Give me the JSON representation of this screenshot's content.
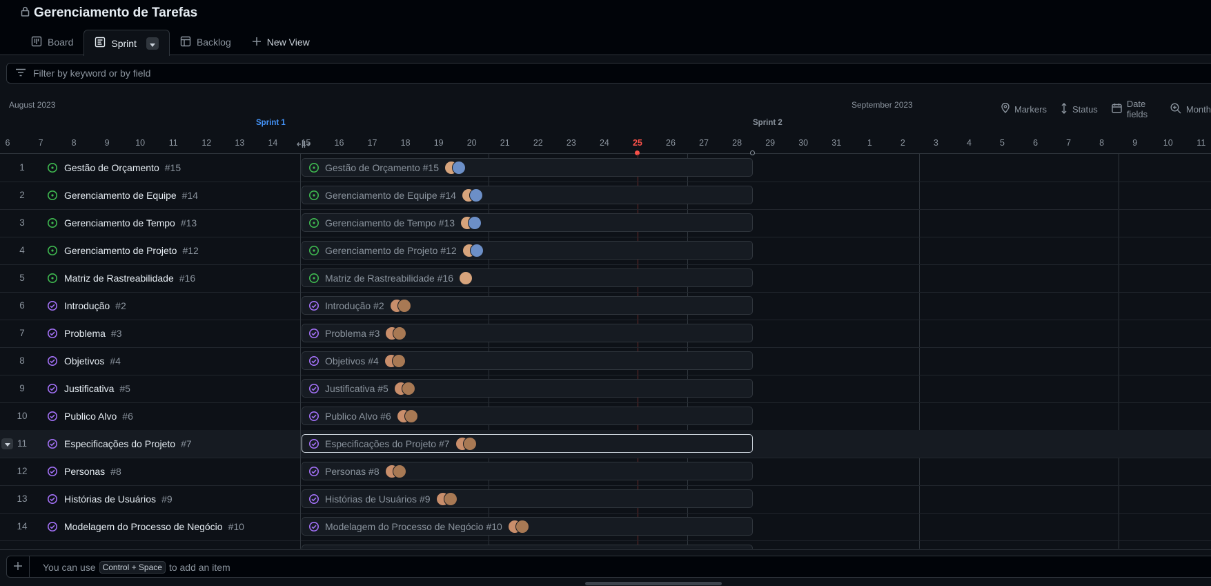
{
  "header": {
    "title": "Gerenciamento de Tarefas",
    "tabs": [
      {
        "label": "Board",
        "icon": "board-icon"
      },
      {
        "label": "Sprint",
        "icon": "roadmap-icon",
        "active": true
      },
      {
        "label": "Backlog",
        "icon": "table-icon"
      },
      {
        "label": "New View",
        "icon": "plus-icon"
      }
    ]
  },
  "filter": {
    "placeholder": "Filter by keyword or by field"
  },
  "timeline": {
    "months": [
      "August 2023",
      "September 2023"
    ],
    "sprints": [
      {
        "label": "Sprint 1",
        "color": "#4493f8"
      },
      {
        "label": "Sprint 2",
        "color": "#8b949e"
      }
    ],
    "days": [
      "6",
      "7",
      "8",
      "9",
      "10",
      "11",
      "12",
      "13",
      "14",
      "15",
      "16",
      "17",
      "18",
      "19",
      "20",
      "21",
      "22",
      "23",
      "24",
      "25",
      "26",
      "27",
      "28",
      "29",
      "30",
      "31",
      "1",
      "2",
      "3",
      "4",
      "5",
      "6",
      "7",
      "8",
      "9",
      "10",
      "11"
    ],
    "today": "25"
  },
  "toolbar": {
    "markers": "Markers",
    "status": "Status",
    "date_fields": "Date fields",
    "zoom": "Month"
  },
  "colors": {
    "in_progress": "#3fb950",
    "done": "#a371f7",
    "today": "#f85149",
    "sprint_active": "#4493f8"
  },
  "rows": [
    {
      "n": "1",
      "title": "Gestão de Orçamento",
      "num": "#15",
      "status": "in_progress",
      "avatars": 2
    },
    {
      "n": "2",
      "title": "Gerenciamento de Equipe",
      "num": "#14",
      "status": "in_progress",
      "avatars": 2
    },
    {
      "n": "3",
      "title": "Gerenciamento de Tempo",
      "num": "#13",
      "status": "in_progress",
      "avatars": 2
    },
    {
      "n": "4",
      "title": "Gerenciamento de Projeto",
      "num": "#12",
      "status": "in_progress",
      "avatars": 2
    },
    {
      "n": "5",
      "title": "Matriz de Rastreabilidade",
      "num": "#16",
      "status": "in_progress",
      "avatars": 1
    },
    {
      "n": "6",
      "title": "Introdução",
      "num": "#2",
      "status": "done",
      "avatars": 2
    },
    {
      "n": "7",
      "title": "Problema",
      "num": "#3",
      "status": "done",
      "avatars": 2
    },
    {
      "n": "8",
      "title": "Objetivos",
      "num": "#4",
      "status": "done",
      "avatars": 2
    },
    {
      "n": "9",
      "title": "Justificativa",
      "num": "#5",
      "status": "done",
      "avatars": 2
    },
    {
      "n": "10",
      "title": "Publico Alvo",
      "num": "#6",
      "status": "done",
      "avatars": 2
    },
    {
      "n": "11",
      "title": "Especificações do Projeto",
      "num": "#7",
      "status": "done",
      "avatars": 2,
      "selected": true
    },
    {
      "n": "12",
      "title": "Personas",
      "num": "#8",
      "status": "done",
      "avatars": 2
    },
    {
      "n": "13",
      "title": "Histórias de Usuários",
      "num": "#9",
      "status": "done",
      "avatars": 2
    },
    {
      "n": "14",
      "title": "Modelagem do Processo de Negócio",
      "num": "#10",
      "status": "done",
      "avatars": 2
    }
  ],
  "footer": {
    "hint_before": "You can use",
    "shortcut": "Control + Space",
    "hint_after": "to add an item"
  }
}
